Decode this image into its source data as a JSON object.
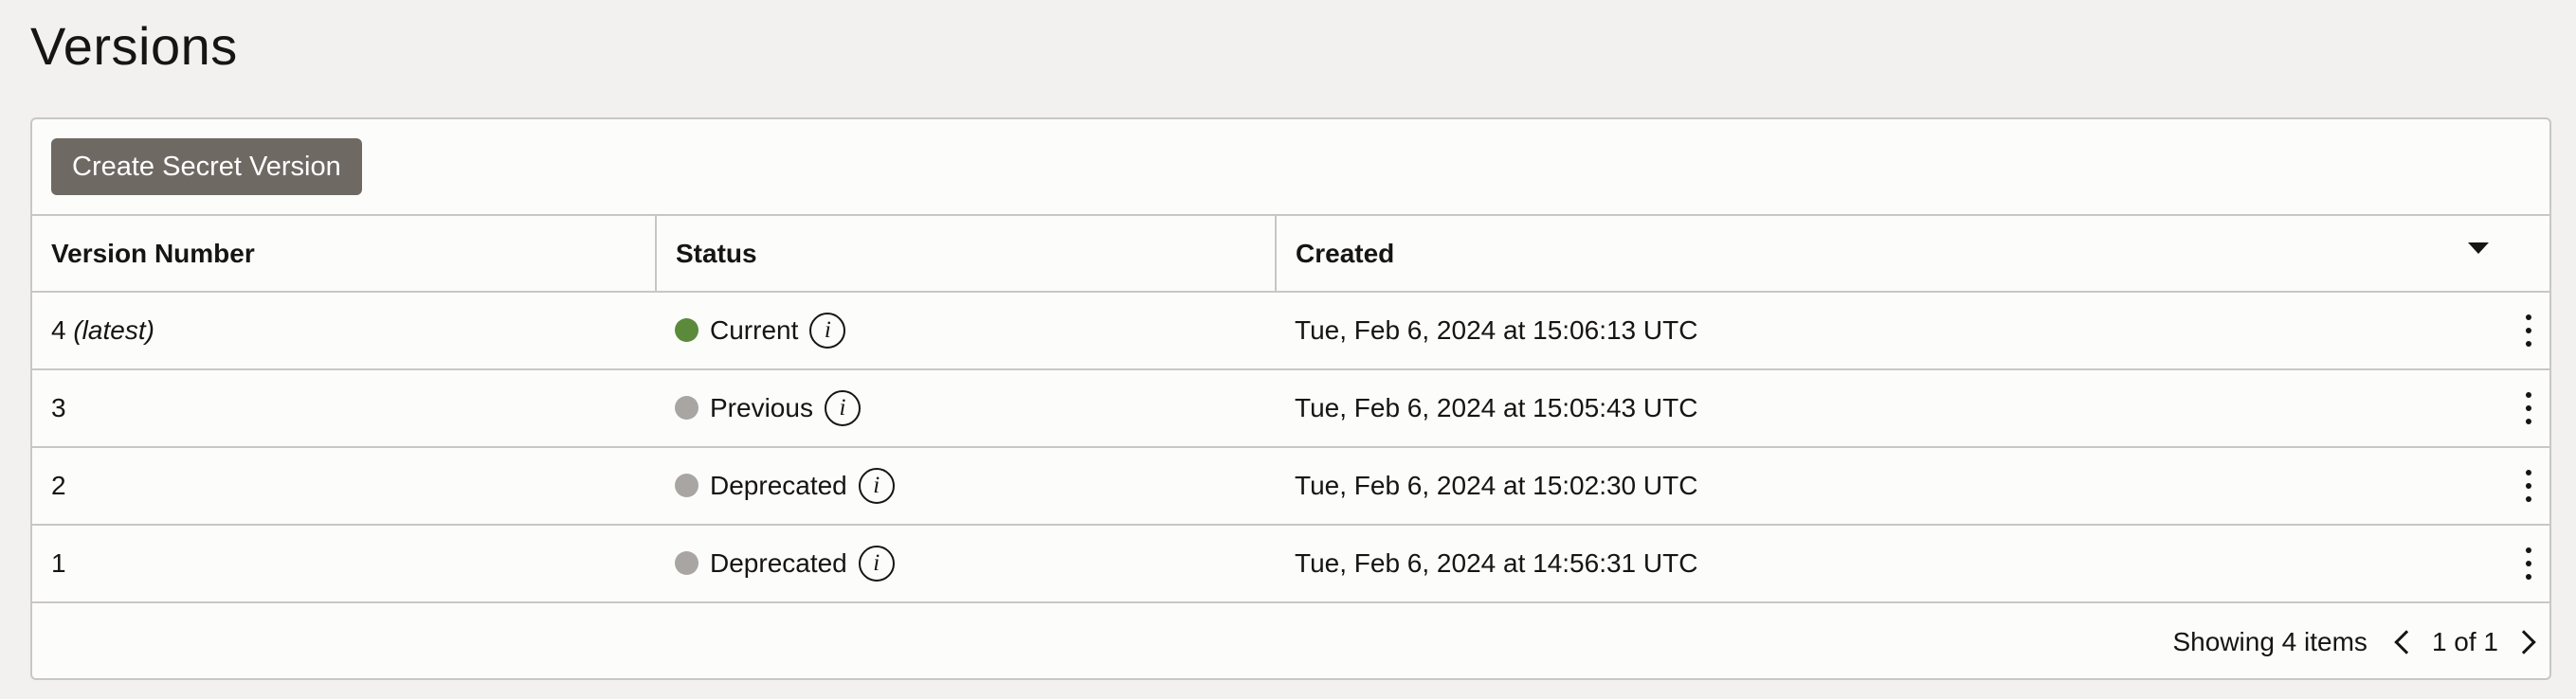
{
  "page": {
    "title": "Versions"
  },
  "toolbar": {
    "create_button": "Create Secret Version"
  },
  "table": {
    "columns": {
      "version": "Version Number",
      "status": "Status",
      "created": "Created"
    },
    "rows": [
      {
        "version": "4",
        "tag": "(latest)",
        "status": "Current",
        "status_color": "#5a8a3a",
        "created": "Tue, Feb 6, 2024 at 15:06:13 UTC"
      },
      {
        "version": "3",
        "tag": "",
        "status": "Previous",
        "status_color": "#a8a5a2",
        "created": "Tue, Feb 6, 2024 at 15:05:43 UTC"
      },
      {
        "version": "2",
        "tag": "",
        "status": "Deprecated",
        "status_color": "#a8a5a2",
        "created": "Tue, Feb 6, 2024 at 15:02:30 UTC"
      },
      {
        "version": "1",
        "tag": "",
        "status": "Deprecated",
        "status_color": "#a8a5a2",
        "created": "Tue, Feb 6, 2024 at 14:56:31 UTC"
      }
    ]
  },
  "footer": {
    "showing": "Showing 4 items",
    "page": "1 of 1"
  },
  "icons": {
    "info": "i",
    "sort": "caret-down-icon",
    "row_menu": "kebab-icon",
    "prev": "chevron-left-icon",
    "next": "chevron-right-icon"
  }
}
